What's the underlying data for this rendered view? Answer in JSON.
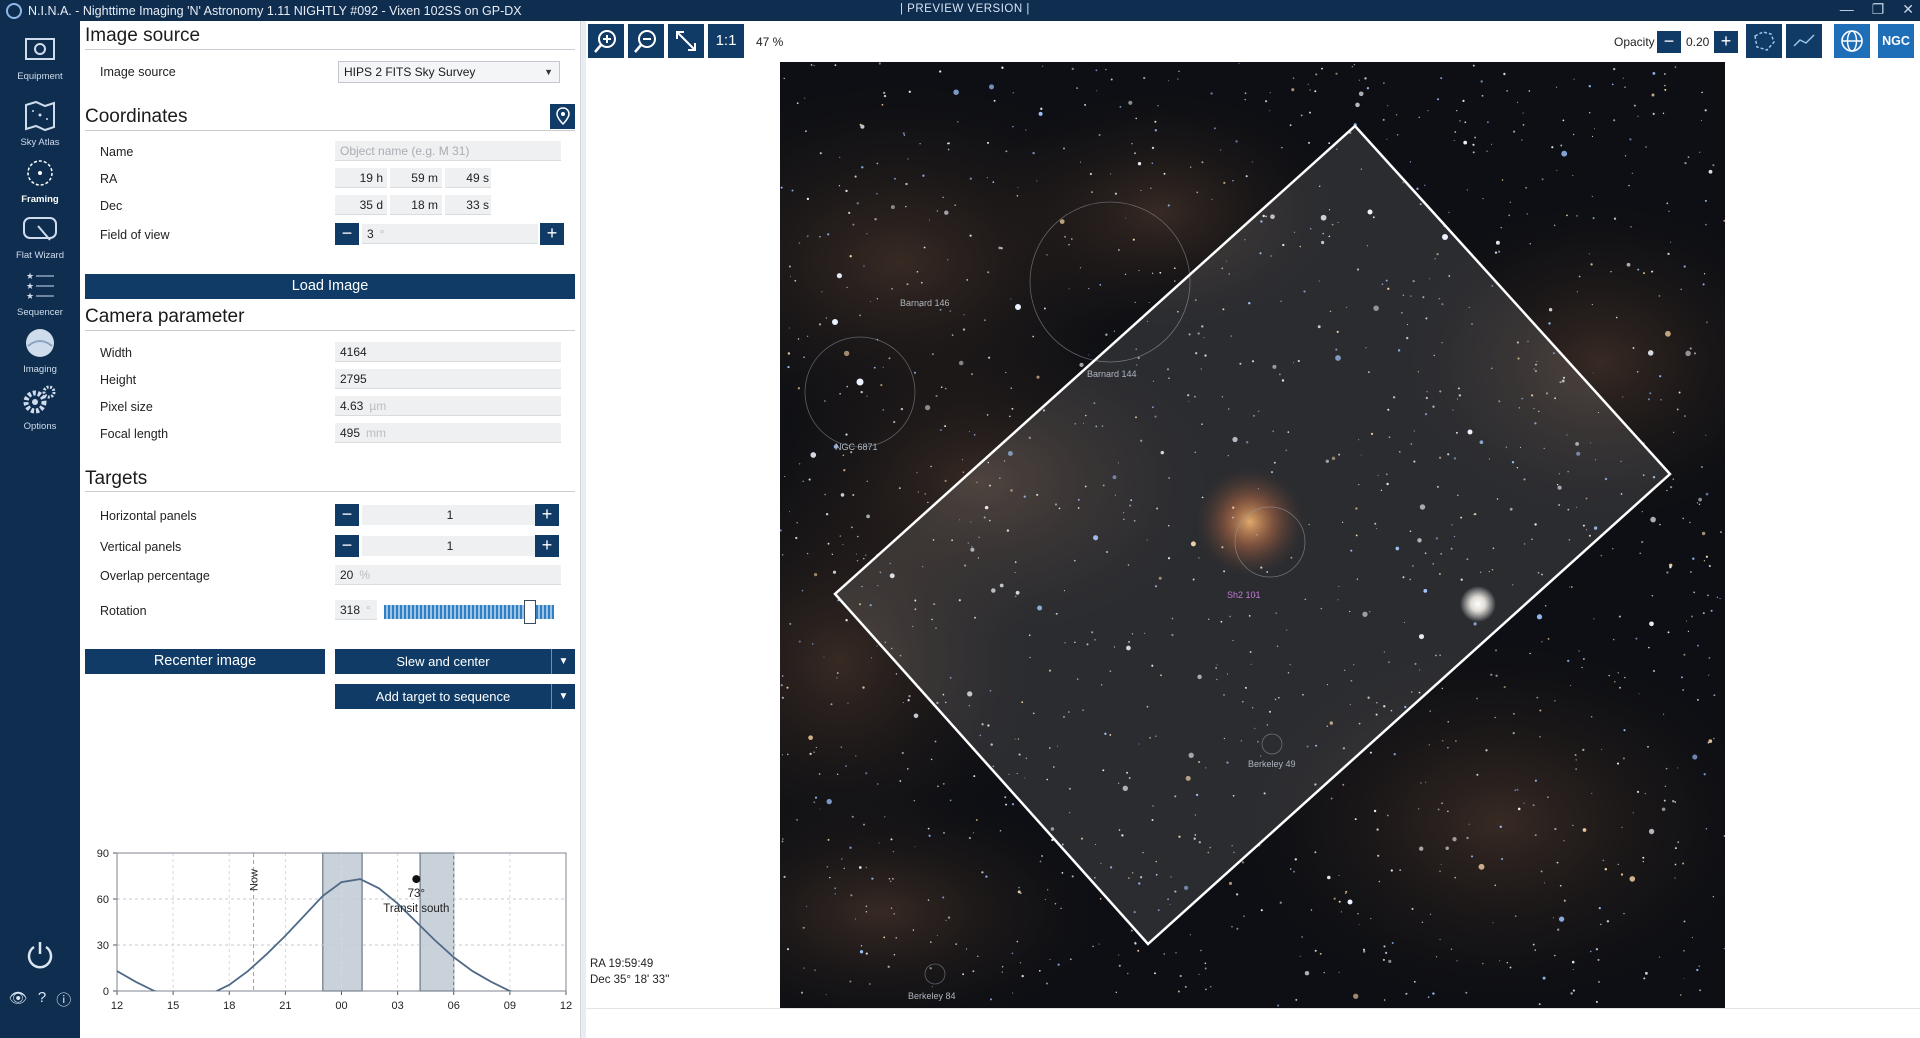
{
  "window": {
    "title": "N.I.N.A. - Nighttime Imaging 'N' Astronomy 1.11 NIGHTLY #092  -  Vixen 102SS on GP-DX",
    "preview_banner": "| PREVIEW VERSION |"
  },
  "nav": {
    "items": [
      {
        "label": "Equipment",
        "icon": "camera-lens-icon"
      },
      {
        "label": "Sky Atlas",
        "icon": "map-icon"
      },
      {
        "label": "Framing",
        "icon": "framing-icon"
      },
      {
        "label": "Flat Wizard",
        "icon": "wand-icon"
      },
      {
        "label": "Sequencer",
        "icon": "star-list-icon"
      },
      {
        "label": "Imaging",
        "icon": "imaging-icon"
      },
      {
        "label": "Options",
        "icon": "gear-icon"
      }
    ],
    "active": "Framing"
  },
  "image_source": {
    "title": "Image source",
    "label": "Image source",
    "value": "HIPS 2 FITS Sky Survey"
  },
  "coordinates": {
    "title": "Coordinates",
    "name_label": "Name",
    "name_placeholder": "Object name (e.g. M 31)",
    "ra_label": "RA",
    "ra_h": "19",
    "ra_h_unit": "h",
    "ra_m": "59",
    "ra_m_unit": "m",
    "ra_s": "49",
    "ra_s_unit": "s",
    "dec_label": "Dec",
    "dec_d": "35",
    "dec_d_unit": "d",
    "dec_m": "18",
    "dec_m_unit": "m",
    "dec_s": "33",
    "dec_s_unit": "s",
    "fov_label": "Field of view",
    "fov_value": "3",
    "fov_unit": "°"
  },
  "load_image_label": "Load Image",
  "camera": {
    "title": "Camera parameter",
    "width_label": "Width",
    "width_value": "4164",
    "height_label": "Height",
    "height_value": "2795",
    "pixel_label": "Pixel size",
    "pixel_value": "4.63",
    "pixel_unit": "µm",
    "focal_label": "Focal length",
    "focal_value": "495",
    "focal_unit": "mm"
  },
  "targets": {
    "title": "Targets",
    "hpanels_label": "Horizontal panels",
    "hpanels_value": "1",
    "vpanels_label": "Vertical panels",
    "vpanels_value": "1",
    "overlap_label": "Overlap percentage",
    "overlap_value": "20",
    "overlap_unit": "%",
    "rotation_label": "Rotation",
    "rotation_value": "318",
    "rotation_unit": "°",
    "rotation_level": 318,
    "rotation_max": 360
  },
  "buttons": {
    "recenter": "Recenter image",
    "slew": "Slew and center",
    "add_target": "Add target to sequence"
  },
  "chart_data": {
    "type": "line",
    "x_ticks": [
      "12",
      "15",
      "18",
      "21",
      "00",
      "03",
      "06",
      "09",
      "12"
    ],
    "y_ticks": [
      "0",
      "30",
      "60",
      "90"
    ],
    "ylim": [
      0,
      90
    ],
    "x_hours_from_noon": [
      0,
      1,
      2,
      3,
      4,
      5,
      6,
      7,
      8,
      9,
      10,
      11,
      12,
      13,
      14,
      15,
      16,
      17,
      18,
      19,
      20,
      21,
      22,
      23,
      24
    ],
    "altitude": [
      13,
      6,
      0,
      -4,
      -6,
      -2,
      4,
      13,
      24,
      36,
      49,
      62,
      71,
      73,
      67,
      57,
      45,
      33,
      22,
      13,
      6,
      0,
      -4,
      -6,
      -2
    ],
    "now_label": "Now",
    "now_hour": 7.3,
    "twilight_bands": [
      [
        11.0,
        13.1
      ],
      [
        16.2,
        18.0
      ]
    ],
    "transit_hour": 16.0,
    "transit_alt": 73,
    "transit_value_label": "73°",
    "transit_text": "Transit south",
    "line_color": "#4f6a86"
  },
  "toolbar": {
    "zoom_in_icon": "zoom-in-icon",
    "zoom_out_icon": "zoom-out-icon",
    "fit_icon": "fit-icon",
    "one_to_one": "1:1",
    "zoom_level": "47 %",
    "opacity_label": "Opacity",
    "opacity_value": "0.20",
    "ngc_label": "NGC"
  },
  "sky": {
    "labels": [
      {
        "text": "Barnard 146"
      },
      {
        "text": "Barnard 144"
      },
      {
        "text": "NGC 6871"
      },
      {
        "text": "Sh2 101"
      },
      {
        "text": "Berkeley 49"
      },
      {
        "text": "Berkeley 84"
      }
    ]
  },
  "readout": {
    "ra": "RA  19:59:49",
    "dec": "Dec  35° 18' 33\""
  }
}
